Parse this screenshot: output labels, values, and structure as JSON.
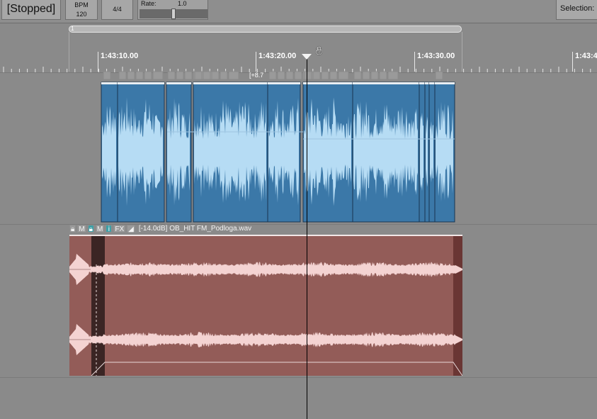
{
  "transport": {
    "state": "[Stopped]",
    "bpm_label": "BPM",
    "bpm_value": "120",
    "time_signature": "4/4",
    "rate_label": "Rate:",
    "rate_value": "1.0",
    "rate_slider_level": 0.5,
    "selection_label": "Selection:"
  },
  "ruler": {
    "region_number": "1",
    "timecodes": [
      "1:43:10.00",
      "1:43:20.00",
      "1:43:30.00",
      "1:43:4"
    ]
  },
  "track1": {
    "offset_label": "[+8.7"
  },
  "track2": {
    "icons": [
      "M",
      "M",
      "i",
      "FX"
    ],
    "clip_label": "[-14.0dB] OB_HIT FM_Podloga.wav"
  },
  "colors": {
    "blue_clip": "#3b78a8",
    "blue_wave": "#b6dcf4",
    "red_clip": "#935c58",
    "red_wave": "#f4d3d2",
    "active_icon": "#3f9fa6"
  }
}
